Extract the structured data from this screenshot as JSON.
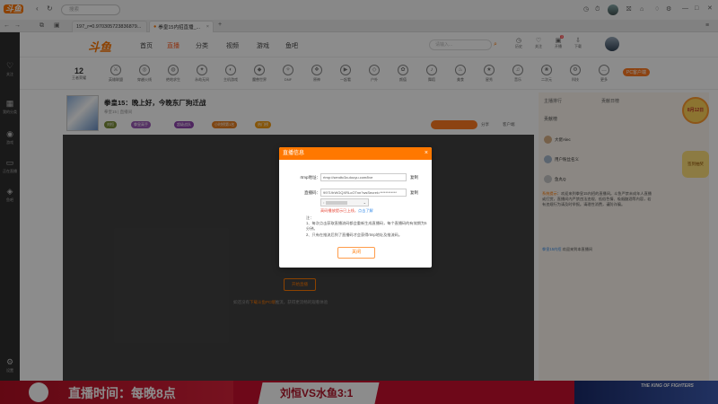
{
  "browser": {
    "search_placeholder": "搜索",
    "tab1_title": "197_r=0.970305723836879...",
    "tab2_title": "拳皇15内招直播_..."
  },
  "sidebar": {
    "items": [
      {
        "label": "关注",
        "icon": "heart-icon"
      },
      {
        "label": "我的分类",
        "icon": "grid-icon"
      },
      {
        "label": "游戏",
        "icon": "gamepad-icon"
      },
      {
        "label": "正在直播",
        "icon": "tv-icon"
      },
      {
        "label": "鱼吧",
        "icon": "fish-icon"
      },
      {
        "label": "设置",
        "icon": "gear-icon"
      }
    ]
  },
  "site": {
    "logo": "斗鱼",
    "nav": [
      "首页",
      "直播",
      "分类",
      "视频",
      "游戏",
      "鱼吧"
    ],
    "search_placeholder": "请输入...",
    "header_icons": [
      "历史",
      "关注",
      "开播",
      "下载"
    ]
  },
  "categories": {
    "first_count": "12",
    "first_label": "王者荣耀",
    "items": [
      "英雄联盟",
      "穿越火线",
      "绝地求生",
      "永劫无间",
      "主机游戏",
      "魔兽世界",
      "DNF",
      "原神",
      "一起看",
      "户外",
      "颜值",
      "舞蹈",
      "美食",
      "星秀",
      "音乐",
      "二次元",
      "科技",
      "更多"
    ],
    "pc_button": "PC客户端"
  },
  "room": {
    "title": "拳皇15：晚上好，今晚东厂狗迁战",
    "meta": "拳皇15 | 直播间",
    "pills": [
      "刘恒",
      "拳皇高手",
      "超级战队",
      "小时榜第1名",
      "热门榜"
    ],
    "share": "分享",
    "report": "客户端"
  },
  "modal": {
    "title": "直播信息",
    "rtmp_label": "rtmp地址：",
    "rtmp_value": "rtmp://sendtc3a.douyu.com/live",
    "stream_label": "直播码：",
    "stream_value": "99719rWGQXRLcOTnn?wsSecret=************",
    "copy_label": "复制",
    "warn_prefix": "高码播放提示已上线，",
    "warn_link": "点击了解",
    "note_title": "注：",
    "note_1": "1、每次点击获取直播流码都会重新生成直播码，每个直播码的有效期为5分钟。",
    "note_2": "2、只有在推流后到了直播码才会获得rtmp地址及推流码。",
    "close_button": "关闭"
  },
  "video": {
    "start_button": "开始直播",
    "hint_prefix": "如还没有",
    "hint_link": "下载斗鱼PC端",
    "hint_suffix": "推流，获得更流畅的观看体验"
  },
  "right_panel": {
    "tabs": [
      "主播排行",
      "贡献日榜"
    ],
    "users": [
      "贡献榜",
      "大佬Alec",
      "用户粉丝名义",
      "鱼丸Q"
    ],
    "notice_label": "系统提示",
    "notice_text": "欢迎来到拳皇15内招的直播间。斗鱼严禁未成年人直播或打赏，直播间内严禁违法违规、低俗色情、吸烟酗酒等内容，若有违规行为请及时举报。请理性消费，谨防诈骗。",
    "chat_name": "拳皇15内招",
    "chat_text": "欢迎来到本直播间",
    "promo_text": "8月12日",
    "promo_sub": "签到抽奖"
  },
  "banner": {
    "left_text": "直播时间：每晚8点",
    "middle_text": "刘恒VS水鱼3:1",
    "right_text": "THE KING OF FIGHTERS"
  }
}
